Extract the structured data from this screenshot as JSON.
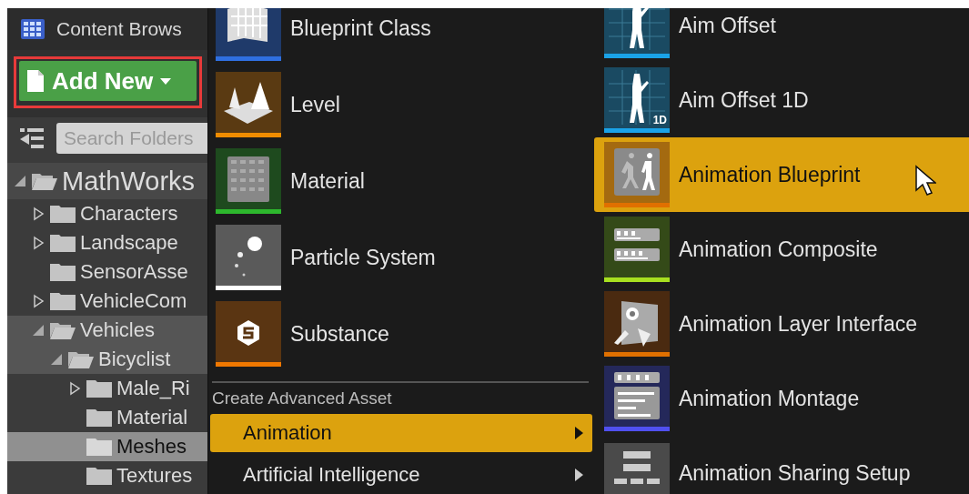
{
  "content_browser": {
    "tab_title": "Content Brows",
    "add_new_button": {
      "label": "Add New"
    },
    "search": {
      "placeholder": "Search Folders"
    },
    "tree": [
      {
        "label": "MathWorks",
        "expanded": true,
        "highlighted": false,
        "selected": false,
        "children": [
          {
            "label": "Characters",
            "expanded": false,
            "highlighted": false,
            "selected": false
          },
          {
            "label": "Landscape",
            "expanded": false,
            "highlighted": false,
            "selected": false
          },
          {
            "label": "SensorAsse",
            "highlighted": false,
            "selected": false
          },
          {
            "label": "VehicleCom",
            "expanded": false,
            "highlighted": false,
            "selected": false
          },
          {
            "label": "Vehicles",
            "expanded": true,
            "highlighted": true,
            "selected": false,
            "children": [
              {
                "label": "Bicyclist",
                "expanded": true,
                "highlighted": true,
                "selected": false,
                "children": [
                  {
                    "label": "Male_Ri",
                    "expanded": false,
                    "highlighted": false,
                    "selected": false
                  },
                  {
                    "label": "Material",
                    "highlighted": false,
                    "selected": false
                  },
                  {
                    "label": "Meshes",
                    "highlighted": false,
                    "selected": true
                  },
                  {
                    "label": "Textures",
                    "highlighted": false,
                    "selected": false
                  }
                ]
              }
            ]
          }
        ]
      }
    ]
  },
  "basic_assets_menu": {
    "items": [
      {
        "label": "Blueprint Class",
        "kind": "blueprint",
        "color": "#2f6fe0"
      },
      {
        "label": "Level",
        "kind": "level",
        "color": "#f08c00"
      },
      {
        "label": "Material",
        "kind": "material",
        "color": "#2db82d"
      },
      {
        "label": "Particle System",
        "kind": "particle",
        "color": "#ffffff"
      },
      {
        "label": "Substance",
        "kind": "substance",
        "color": "#f07800"
      }
    ],
    "section_header": "Create Advanced Asset",
    "categories": [
      {
        "label": "Animation",
        "selected": true
      },
      {
        "label": "Artificial Intelligence",
        "selected": false
      }
    ]
  },
  "animation_submenu": {
    "items": [
      {
        "label": "Aim Offset",
        "kind": "aim",
        "color": "#1aa3e8",
        "selected": false
      },
      {
        "label": "Aim Offset 1D",
        "kind": "aim",
        "color": "#1aa3e8",
        "badge": "1D",
        "selected": false
      },
      {
        "label": "Animation Blueprint",
        "kind": "anim_blueprint",
        "color": "#e07000",
        "selected": true
      },
      {
        "label": "Animation Composite",
        "kind": "composite",
        "color": "#a8e020",
        "selected": false
      },
      {
        "label": "Animation Layer Interface",
        "kind": "layer",
        "color": "#e07000",
        "selected": false
      },
      {
        "label": "Animation Montage",
        "kind": "montage",
        "color": "#5050f0",
        "selected": false
      },
      {
        "label": "Animation Sharing Setup",
        "kind": "sharing",
        "selected": false
      }
    ]
  }
}
